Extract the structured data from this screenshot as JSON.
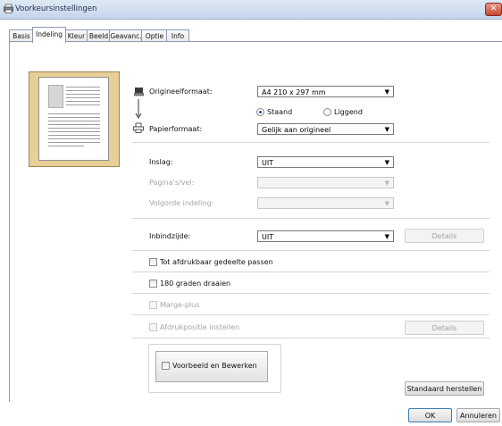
{
  "window": {
    "title": "Voorkeursinstellingen",
    "close_label": "✕"
  },
  "tabs": [
    {
      "label": "Basis"
    },
    {
      "label": "Indeling"
    },
    {
      "label": "Kleur"
    },
    {
      "label": "Beeld"
    },
    {
      "label": "Geavanc."
    },
    {
      "label": "Optie"
    },
    {
      "label": "Info"
    }
  ],
  "active_tab": "Indeling",
  "layout": {
    "original_size": {
      "label": "Origineelformaat:",
      "value": "A4 210 x 297 mm"
    },
    "orientation": {
      "option_portrait": "Staand",
      "option_landscape": "Liggend",
      "selected": "Staand"
    },
    "paper_size": {
      "label": "Papierformaat:",
      "value": "Gelijk aan origineel"
    },
    "imposition": {
      "label": "Inslag:",
      "value": "UIT"
    },
    "pages_per_sheet": {
      "label": "Pagina's/vel:",
      "value": ""
    },
    "page_order": {
      "label": "Volgorde indeling:",
      "value": ""
    },
    "binding_side": {
      "label": "Inbindzijde:",
      "value": "UIT",
      "details_label": "Details"
    },
    "fit_printable": {
      "label": "Tot afdrukbaar gedeelte passen",
      "checked": false
    },
    "rotate_180": {
      "label": "180 graden draaien",
      "checked": false
    },
    "margin_plus": {
      "label": "Marge-plus",
      "checked": false
    },
    "print_position": {
      "label": "Afdrukpositie instellen",
      "checked": false,
      "details_label": "Details"
    },
    "preview_edit": {
      "label": "Voorbeeld en Bewerken",
      "checked": false
    },
    "restore_defaults_label": "Standaard herstellen"
  },
  "footer": {
    "ok_label": "OK",
    "cancel_label": "Annuleren"
  },
  "colors": {
    "title_bar": "#c4d5eb",
    "preview_frame": "#e8cf98",
    "radio_accent": "#1c55b7",
    "close_button": "#c74732"
  }
}
